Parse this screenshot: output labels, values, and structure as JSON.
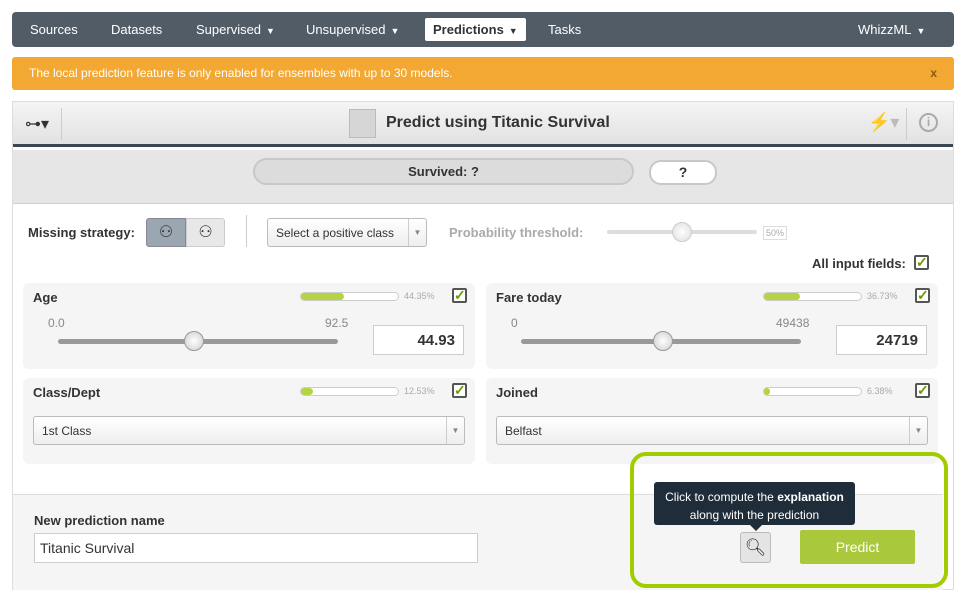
{
  "nav": {
    "items": [
      {
        "label": "Sources"
      },
      {
        "label": "Datasets"
      },
      {
        "label": "Supervised",
        "dropdown": true
      },
      {
        "label": "Unsupervised",
        "dropdown": true
      },
      {
        "label": "Predictions",
        "dropdown": true,
        "active": true
      },
      {
        "label": "Tasks"
      }
    ],
    "right": "WhizzML"
  },
  "alert": {
    "text": "The local prediction feature is only enabled for ensembles with up to 30 models.",
    "close": "x"
  },
  "header": {
    "title": "Predict using Titanic Survival"
  },
  "result": {
    "text": "Survived: ?",
    "value": "?"
  },
  "controls": {
    "missing_label": "Missing strategy:",
    "positive_class": "Select a positive class",
    "threshold_label": "Probability threshold:",
    "threshold": "50%",
    "all_fields": "All input fields:"
  },
  "fields": [
    {
      "name": "Age",
      "importance": "44.35%",
      "imp": 44.35,
      "min": "0.0",
      "max": "92.5",
      "value": "44.93"
    },
    {
      "name": "Fare today",
      "importance": "36.73%",
      "imp": 36.73,
      "min": "0",
      "max": "49438",
      "value": "24719"
    },
    {
      "name": "Class/Dept",
      "importance": "12.53%",
      "imp": 12.53,
      "value": "1st Class"
    },
    {
      "name": "Joined",
      "importance": "6.38%",
      "imp": 6.38,
      "value": "Belfast"
    }
  ],
  "prediction": {
    "name_label": "New prediction name",
    "name_value": "Titanic Survival",
    "predict": "Predict",
    "tooltip_pre": "Click to compute the ",
    "tooltip_bold": "explanation",
    "tooltip_post": "along with the prediction"
  },
  "colors": {
    "accent": "#a0cc00",
    "nav": "#525c66",
    "alert": "#f2a832"
  }
}
